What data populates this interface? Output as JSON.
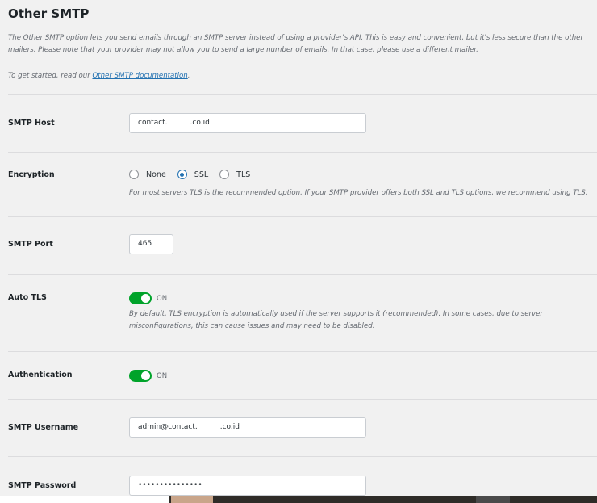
{
  "section": {
    "title": "Other SMTP",
    "intro": "The Other SMTP option lets you send emails through an SMTP server instead of using a provider's API. This is easy and convenient, but it's less secure than the other mailers. Please note that your provider may not allow you to send a large number of emails. In that case, please use a different mailer.",
    "getting_started_prefix": "To get started, read our ",
    "doc_link": "Other SMTP documentation",
    "getting_started_suffix": "."
  },
  "fields": {
    "host": {
      "label": "SMTP Host",
      "value_start": "contact.",
      "value_end": ".co.id"
    },
    "encryption": {
      "label": "Encryption",
      "options": [
        "None",
        "SSL",
        "TLS"
      ],
      "selected": "SSL",
      "help": "For most servers TLS is the recommended option. If your SMTP provider offers both SSL and TLS options, we recommend using TLS."
    },
    "port": {
      "label": "SMTP Port",
      "value": "465"
    },
    "auto_tls": {
      "label": "Auto TLS",
      "state": "ON",
      "help": "By default, TLS encryption is automatically used if the server supports it (recommended). In some cases, due to server misconfigurations, this can cause issues and may need to be disabled."
    },
    "authentication": {
      "label": "Authentication",
      "state": "ON"
    },
    "username": {
      "label": "SMTP Username",
      "value_start": "admin@contact.",
      "value_end": ".co.id"
    },
    "password": {
      "label": "SMTP Password",
      "value": "•••••••••••••••"
    }
  },
  "colors": {
    "toggle_on": "#00a32a",
    "link": "#2271b1",
    "radio_checked": "#2271b1"
  }
}
